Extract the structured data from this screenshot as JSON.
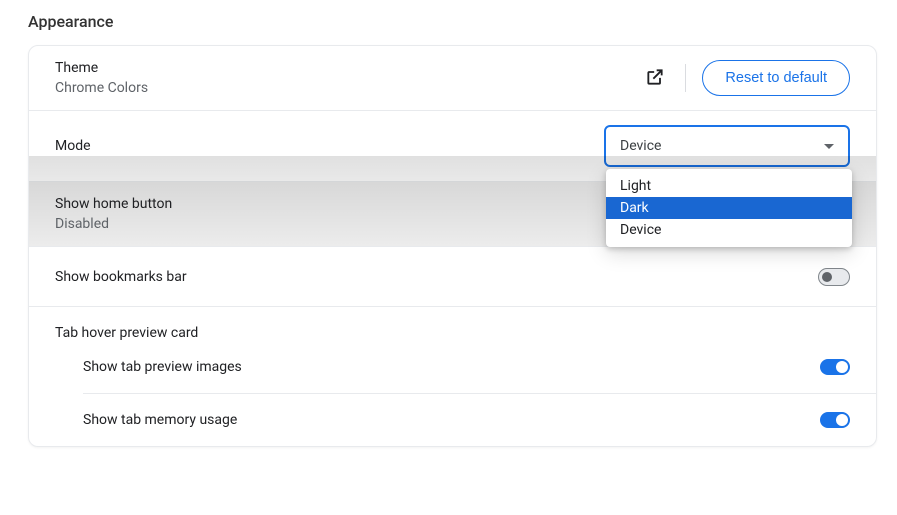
{
  "section_title": "Appearance",
  "theme": {
    "label": "Theme",
    "value": "Chrome Colors",
    "reset_label": "Reset to default"
  },
  "mode": {
    "label": "Mode",
    "selected": "Device",
    "options": [
      "Light",
      "Dark",
      "Device"
    ],
    "highlighted": "Dark"
  },
  "home_button": {
    "label": "Show home button",
    "value": "Disabled",
    "enabled": false
  },
  "bookmarks_bar": {
    "label": "Show bookmarks bar",
    "enabled": false
  },
  "tab_hover": {
    "label": "Tab hover preview card",
    "preview_images": {
      "label": "Show tab preview images",
      "enabled": true
    },
    "memory_usage": {
      "label": "Show tab memory usage",
      "enabled": true
    }
  }
}
